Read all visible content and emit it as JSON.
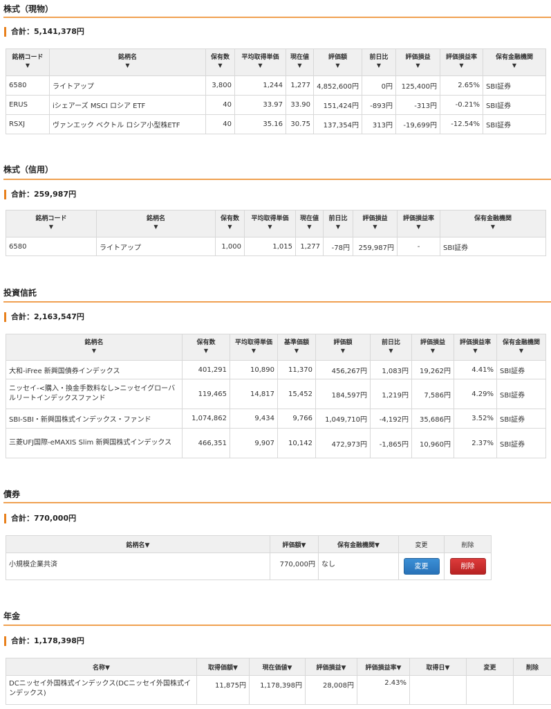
{
  "theme": {
    "accent": "#e8801c",
    "negative": "#c0392b",
    "positive": "#2a6cb8",
    "header_bg": "#f0f0f0"
  },
  "sort_arrow": "▼",
  "stocks_cash": {
    "title": "株式（現物）",
    "total": "合計：5,141,378円",
    "headers": [
      "銘柄コード",
      "銘柄名",
      "保有数",
      "平均取得単価",
      "現在値",
      "評価額",
      "前日比",
      "評価損益",
      "評価損益率",
      "保有金融機関"
    ],
    "rows": [
      [
        "6580",
        "ライトアップ",
        "3,800",
        "1,244",
        "1,277",
        "4,852,600円",
        "0円",
        "125,400円",
        "2.65%",
        "SBI証券"
      ],
      [
        "ERUS",
        "iシェアーズ MSCI ロシア ETF",
        "40",
        "33.97",
        "33.90",
        "151,424円",
        "-893円",
        "-313円",
        "-0.21%",
        "SBI証券"
      ],
      [
        "RSXJ",
        "ヴァンエック ベクトル ロシア小型株ETF",
        "40",
        "35.16",
        "30.75",
        "137,354円",
        "313円",
        "-19,699円",
        "-12.54%",
        "SBI証券"
      ]
    ]
  },
  "stocks_margin": {
    "title": "株式（信用）",
    "total": "合計：259,987円",
    "headers": [
      "銘柄コード",
      "銘柄名",
      "保有数",
      "平均取得単価",
      "現在値",
      "前日比",
      "評価損益",
      "評価損益率",
      "保有金融機関"
    ],
    "rows": [
      [
        "6580",
        "ライトアップ",
        "1,000",
        "1,015",
        "1,277",
        "-78円",
        "259,987円",
        "-",
        "SBI証券"
      ]
    ]
  },
  "funds": {
    "title": "投資信託",
    "total": "合計：2,163,547円",
    "headers": [
      "銘柄名",
      "保有数",
      "平均取得単価",
      "基準価額",
      "評価額",
      "前日比",
      "評価損益",
      "評価損益率",
      "保有金融機関"
    ],
    "rows": [
      [
        "大和-iFree 新興国債券インデックス",
        "401,291",
        "10,890",
        "11,370",
        "456,267円",
        "1,083円",
        "19,262円",
        "4.41%",
        "SBI証券"
      ],
      [
        "ニッセイ-<購入・換金手数料なし>ニッセイグローバルリートインデックスファンド",
        "119,465",
        "14,817",
        "15,452",
        "184,597円",
        "1,219円",
        "7,586円",
        "4.29%",
        "SBI証券"
      ],
      [
        "SBI-SBI・新興国株式インデックス・ファンド",
        "1,074,862",
        "9,434",
        "9,766",
        "1,049,710円",
        "-4,192円",
        "35,686円",
        "3.52%",
        "SBI証券"
      ],
      [
        "三菱UFJ国際-eMAXIS Slim 新興国株式インデックス",
        "466,351",
        "9,907",
        "10,142",
        "472,973円",
        "-1,865円",
        "10,960円",
        "2.37%",
        "SBI証券"
      ]
    ]
  },
  "bonds": {
    "title": "債券",
    "total": "合計：770,000円",
    "headers": [
      "銘柄名▼",
      "評価額▼",
      "保有金融機関▼",
      "変更",
      "削除"
    ],
    "rows": [
      {
        "name": "小規模企業共済",
        "value": "770,000円",
        "institution": "なし",
        "edit": "変更",
        "delete": "削除"
      }
    ]
  },
  "pension": {
    "title": "年金",
    "total": "合計：1,178,398円",
    "headers": [
      "名称▼",
      "取得価額▼",
      "現在価値▼",
      "評価損益▼",
      "評価損益率▼",
      "取得日▼",
      "変更",
      "削除"
    ],
    "rows": [
      [
        "DCニッセイ外国株式インデックス(DCニッセイ外国株式インデックス)",
        "11,875円",
        "1,178,398円",
        "28,008円",
        "2.43%",
        "",
        "",
        ""
      ]
    ]
  }
}
